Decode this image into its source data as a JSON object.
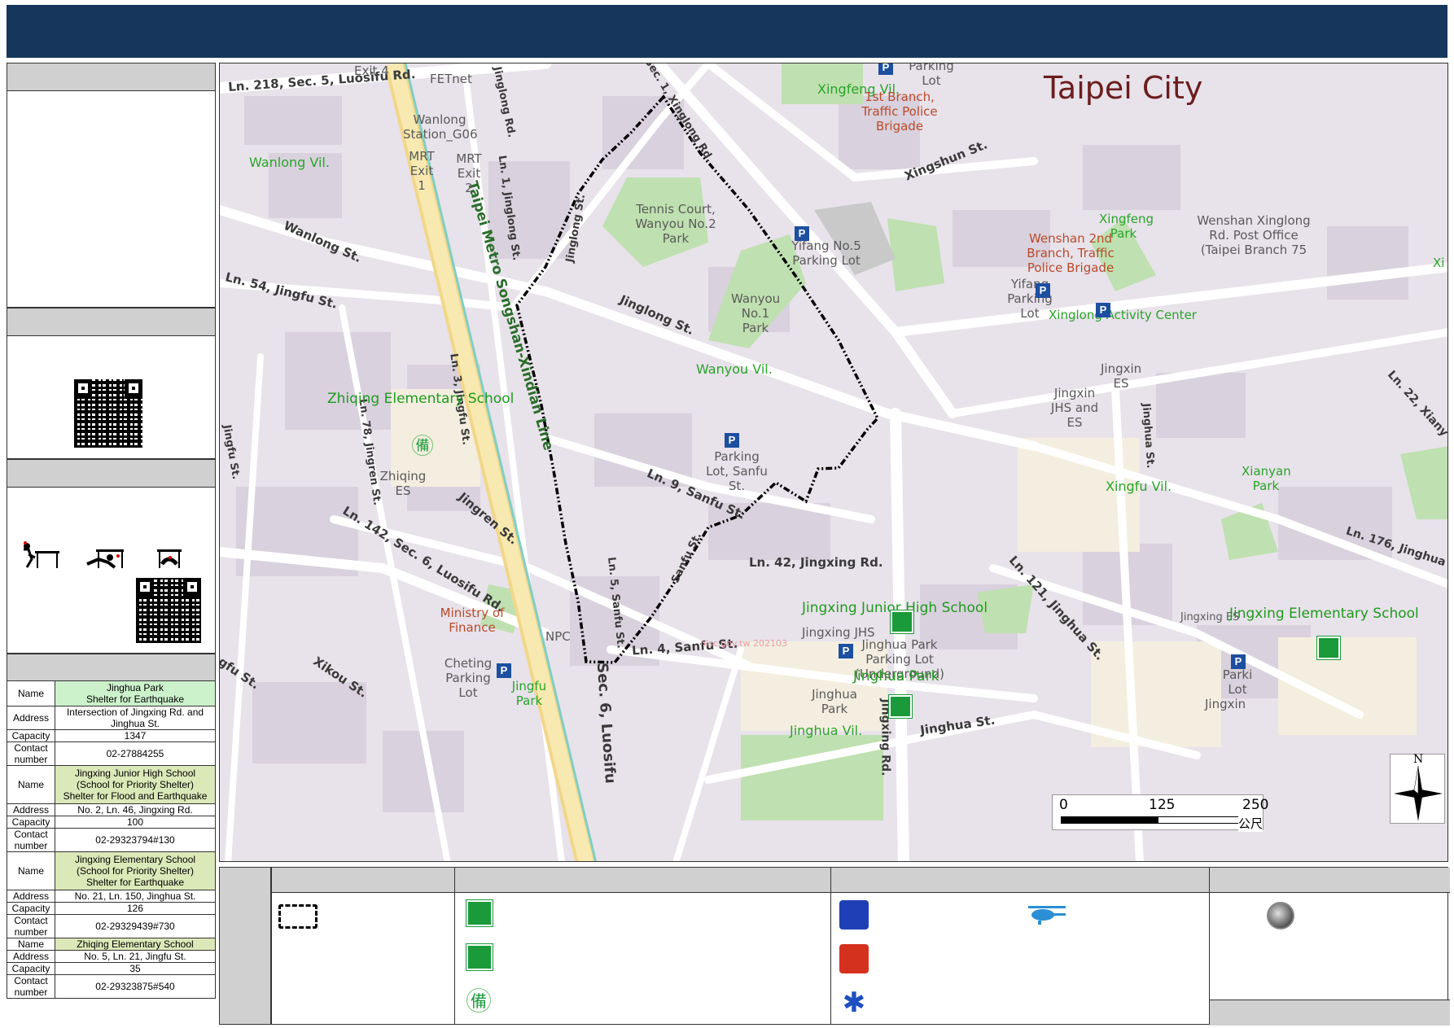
{
  "map": {
    "city_label": "Taipei City",
    "streets": {
      "luosifu5": "Ln. 218, Sec. 5, Luosifu Rd.",
      "exit4": "Exit 4",
      "fetnet": "FETnet",
      "jinglong_rd": "Jinglong Rd.",
      "xinglong1": "Sec. 1, Xinglong Rd.",
      "wanlong_st": "Wanlong St.",
      "jingfu54": "Ln. 54, Jingfu St.",
      "jinglong_st": "Jinglong St.",
      "xingshun_st": "Xingshun St.",
      "metro": "Taipei Metro Songshan-Xindian Line",
      "jingfu_st_a": "Ln. 3, Jingfu St.",
      "jingren78": "Ln. 78, Jingren St.",
      "jingren_st": "Jingren St.",
      "jingfu_st_left": "Jingfu St.",
      "luosifu142": "Ln. 142, Sec. 6, Luosifu Rd.",
      "sanfu9": "Ln. 9, Sanfu St.",
      "sanfu5": "Ln. 5, Sanfu St.",
      "sanfu4": "Ln. 4, Sanfu St.",
      "jingxing42": "Ln. 42, Jingxing Rd.",
      "jingxing_rd": "Jingxing Rd.",
      "jinghua_st": "Jinghua St.",
      "jinghua_st_r": "Jinghua St.",
      "jinghua121": "Ln. 121, Jinghua St.",
      "jinghua176": "Ln. 176, Jinghua St.",
      "xiangyang22": "Ln. 22, Xiany",
      "xikou_st": "Xikou St.",
      "luosifu_sec6": "Sec. 6, Luosifu",
      "jinglong1": "Ln. 1, Jinglong St.",
      "jinglong_st_mid": "Jinglong St.",
      "sanfu_st": "Sanfu St.",
      "jingfu_lower": "gfu St."
    },
    "villages": {
      "wanlong": "Wanlong Vil.",
      "xingfeng": "Xingfeng Vil.",
      "wanyou": "Wanyou Vil.",
      "xingfu": "Xingfu Vil.",
      "jinghua": "Jinghua Vil."
    },
    "pois": {
      "wanlong_station": "Wanlong Station_G06",
      "mrt1": "MRT Exit 1",
      "mrt2": "MRT Exit 2",
      "tennis": "Tennis Court, Wanyou No.2 Park",
      "yifang5": "Yifang No.5 Parking Lot",
      "wanyou1": "Wanyou No.1 Park",
      "parking_top": "Parking Lot",
      "traffic1": "1st Branch, Traffic Police Brigade",
      "wenshan2": "Wenshan 2nd Branch, Traffic Police Brigade",
      "xingfeng_park": "Xingfeng Park",
      "post_office": "Wenshan Xinglong Rd. Post Office (Taipei Branch 75",
      "yifang_parking": "Yifang Parking Lot",
      "xinglong_activity": "Xinglong Activity Center",
      "jingxin_es": "Jingxin ES",
      "jingxin_jhs": "Jingxin JHS and ES",
      "xianyan": "Xianyan Park",
      "zhiqing_es": "Zhiqing ES",
      "parking_sanfu": "Parking Lot, Sanfu St.",
      "ministry": "Ministry of Finance",
      "npc": "NPC",
      "cheting": "Cheting Parking Lot",
      "jingfu_park": "Jingfu Park",
      "jingxing_jhs": "Jingxing JHS",
      "jinghua_parking": "Jinghua Park Parking Lot (Underground)",
      "jinghua_park": "Jinghua Park",
      "jingxing_es_small": "Jingxing ES",
      "parking_right": "Parki Lot",
      "jingxin_cut": "Jingxin",
      "xi": "Xi",
      "watermark": "nlsc.gov.tw 202103"
    },
    "shelters": {
      "zhiqing": "Zhiqing Elementary School",
      "jingxing_jhs": "Jingxing Junior High School",
      "jingxing_es": "Jingxing Elementary School",
      "jinghua_park": "Jinghua Park"
    },
    "scale": {
      "t0": "0",
      "t1": "125",
      "t2": "250",
      "unit": "公尺"
    },
    "north": "N"
  },
  "shelter_table": [
    {
      "name": "Jinghua Park\nShelter for Earthquake",
      "address": "Intersection of Jingxing Rd. and Jinghua St.",
      "capacity": "1347",
      "contact": "02-27884255"
    },
    {
      "name": "Jingxing Junior High School\n(School for Priority Shelter)\nShelter for Flood and Earthquake",
      "address": "No. 2, Ln. 46, Jingxing Rd.",
      "capacity": "100",
      "contact": "02-29323794#130"
    },
    {
      "name": "Jingxing Elementary School\n(School for Priority Shelter)\nShelter for Earthquake",
      "address": "No. 21, Ln. 150, Jinghua St.",
      "capacity": "126",
      "contact": "02-29329439#730"
    },
    {
      "name": "Zhiqing Elementary School",
      "address": "No. 5, Ln. 21, Jingfu St.",
      "capacity": "35",
      "contact": "02-29323875#540"
    }
  ],
  "table_keys": {
    "name": "Name",
    "address": "Address",
    "capacity": "Capacity",
    "contact": "Contact number"
  },
  "legend": {
    "bei_glyph": "備"
  },
  "colors": {
    "title_bar": "#16365c",
    "shelter_green": "#1a9a3a",
    "boundary": "#000000"
  }
}
